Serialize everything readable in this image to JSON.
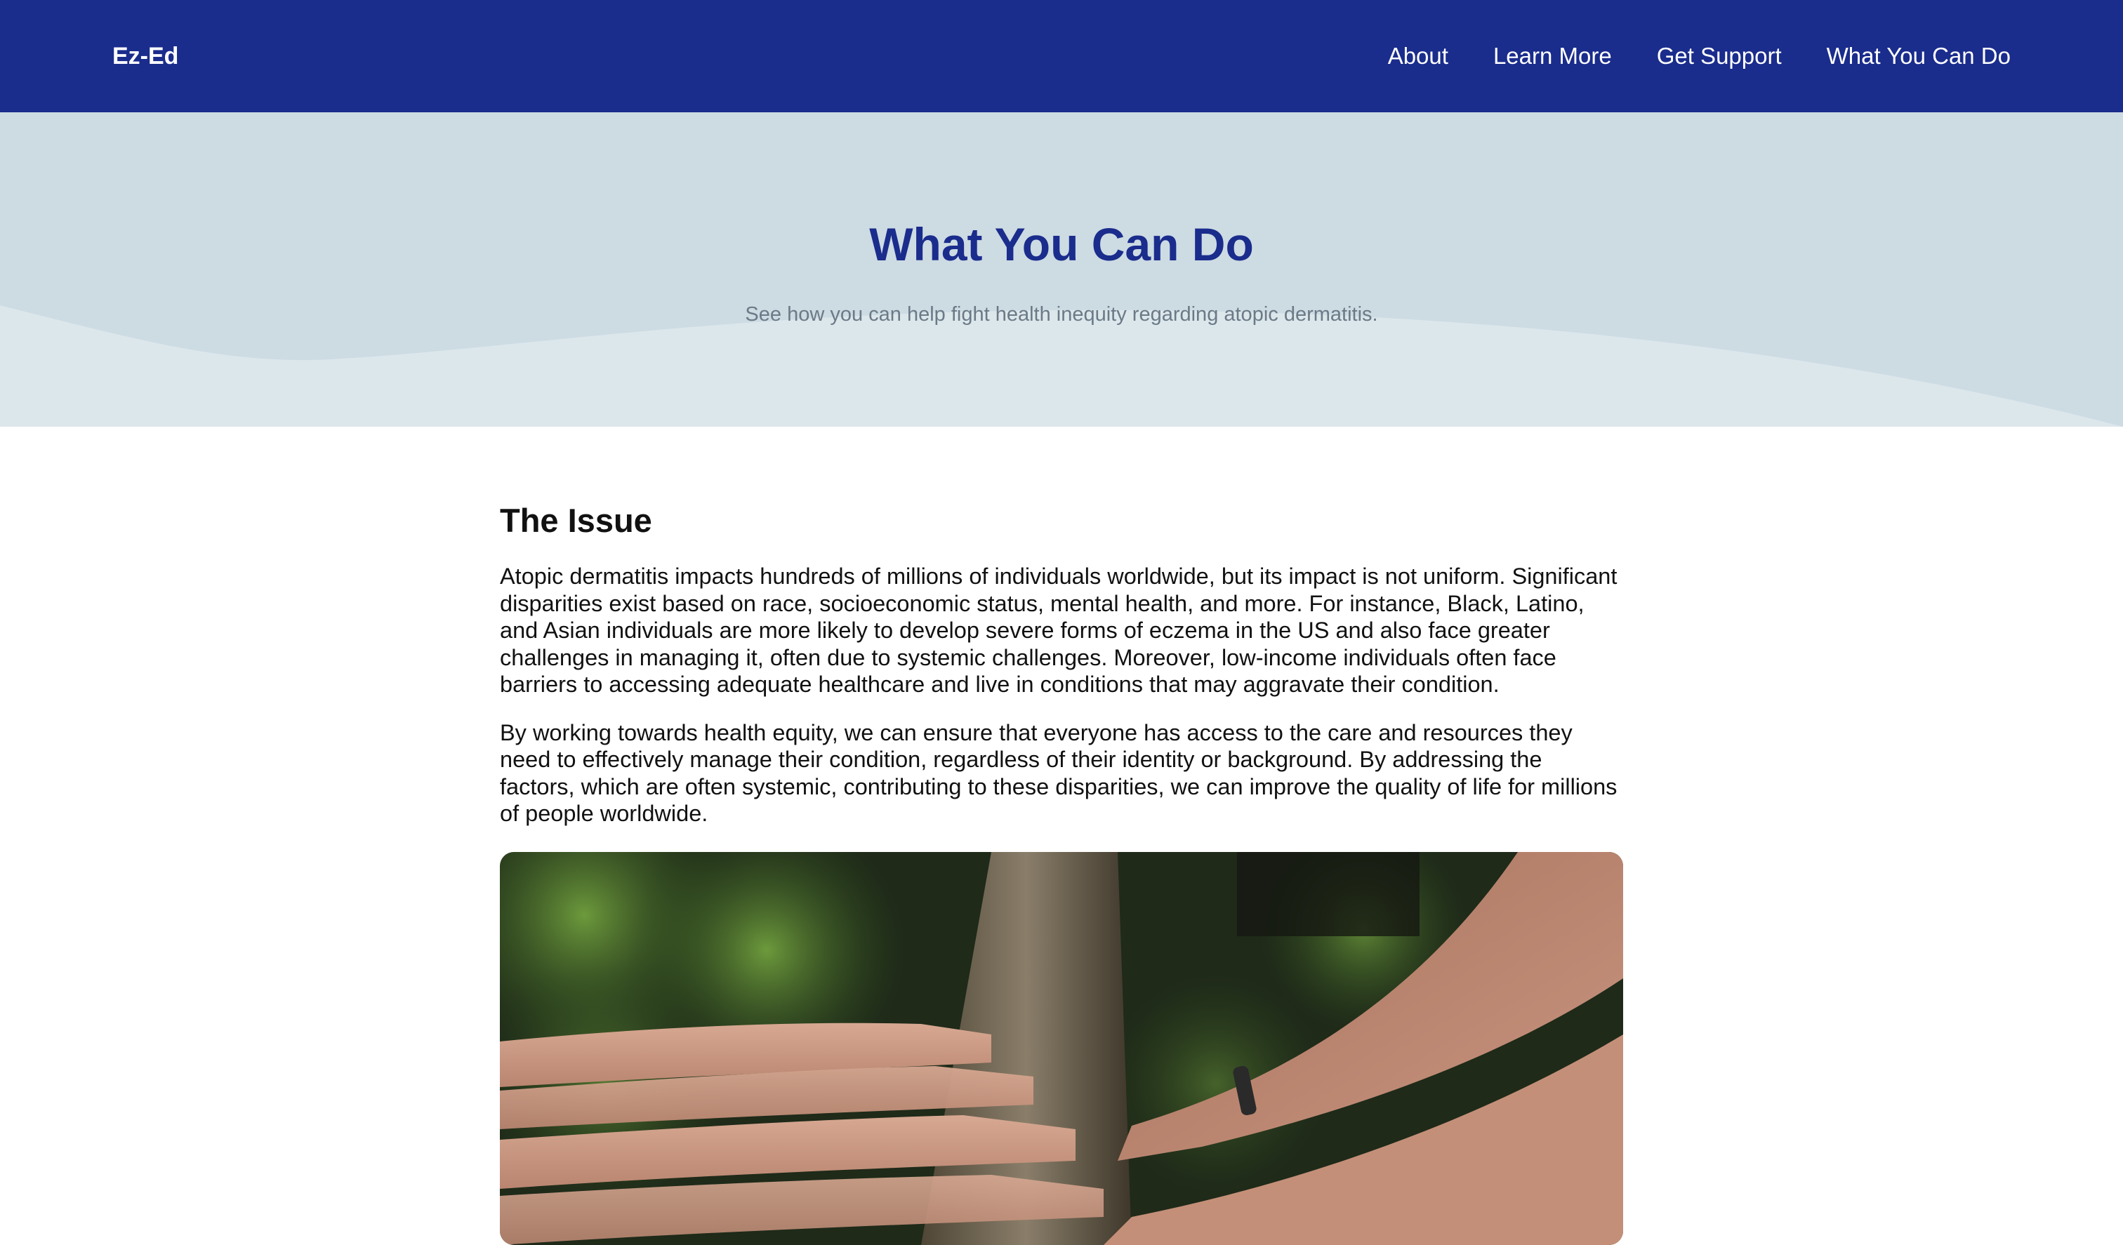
{
  "nav": {
    "brand": "Ez-Ed",
    "links": [
      "About",
      "Learn More",
      "Get Support",
      "What You Can Do"
    ]
  },
  "hero": {
    "title": "What You Can Do",
    "subtitle": "See how you can help fight health inequity regarding atopic dermatitis."
  },
  "issue": {
    "heading": "The Issue",
    "paragraphs": [
      "Atopic dermatitis impacts hundreds of millions of individuals worldwide, but its impact is not uniform. Significant disparities exist based on race, socioeconomic status, mental health, and more. For instance, Black, Latino, and Asian individuals are more likely to develop severe forms of eczema in the US and also face greater challenges in managing it, often due to systemic challenges. Moreover, low-income individuals often face barriers to accessing adequate healthcare and live in conditions that may aggravate their condition.",
      "By working towards health equity, we can ensure that everyone has access to the care and resources they need to effectively manage their condition, regardless of their identity or background. By addressing the factors, which are often systemic, contributing to these disparities, we can improve the quality of life for millions of people worldwide."
    ]
  },
  "colors": {
    "nav_bg": "#1a2c8c",
    "hero_bg": "#cddbe3",
    "hero_wave": "#dce7ec",
    "title_color": "#1a2c8c"
  }
}
